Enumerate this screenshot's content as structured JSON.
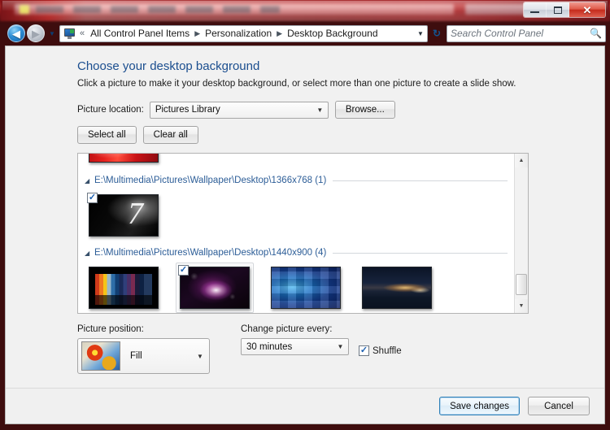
{
  "window": {
    "controls": {
      "minimize": "Minimize",
      "maximize": "Maximize",
      "close": "✕"
    }
  },
  "navbar": {
    "back_glyph": "◀",
    "forward_glyph": "▶",
    "history_glyph": "▼",
    "control_panel_icon": "control-panel-icon",
    "double_chevron": "«",
    "breadcrumbs": [
      "All Control Panel Items",
      "Personalization",
      "Desktop Background"
    ],
    "crumb_arrow": "▶",
    "dropdown_glyph": "▼",
    "refresh_glyph": "↻",
    "search": {
      "placeholder": "Search Control Panel",
      "icon": "🔍"
    }
  },
  "page": {
    "title": "Choose your desktop background",
    "subtitle": "Click a picture to make it your desktop background, or select more than one picture to create a slide show."
  },
  "location": {
    "label": "Picture location:",
    "value": "Pictures Library",
    "arrow": "▼",
    "browse_label": "Browse..."
  },
  "selection": {
    "select_all_label": "Select all",
    "clear_all_label": "Clear all"
  },
  "picture_list": {
    "partial_group_thumb": {
      "name": "red-abstract-wallpaper",
      "art": "wp-red",
      "checked": false
    },
    "groups": [
      {
        "arrow": "◢",
        "title": "E:\\Multimedia\\Pictures\\Wallpaper\\Desktop\\1366x768 (1)",
        "thumbs": [
          {
            "name": "windows-7-logo-wallpaper",
            "art": "wp-win7",
            "checked": true,
            "check_glyph": "✓"
          }
        ]
      },
      {
        "arrow": "◢",
        "title": "E:\\Multimedia\\Pictures\\Wallpaper\\Desktop\\1440x900 (4)",
        "thumbs": [
          {
            "name": "color-panels-wallpaper",
            "art": "wp-panels",
            "checked": false
          },
          {
            "name": "purple-nebula-wallpaper",
            "art": "wp-nebula",
            "checked": true,
            "check_glyph": "✓"
          },
          {
            "name": "blue-mosaic-wallpaper",
            "art": "wp-mosaic",
            "checked": false
          },
          {
            "name": "night-coast-wallpaper",
            "art": "wp-coast",
            "checked": false
          }
        ]
      }
    ],
    "scrollbar": {
      "up_glyph": "▲",
      "down_glyph": "▼"
    }
  },
  "picture_position": {
    "label": "Picture position:",
    "value": "Fill",
    "arrow": "▼",
    "preview": "flower-preview"
  },
  "interval": {
    "label": "Change picture every:",
    "value": "30 minutes",
    "arrow": "▼"
  },
  "shuffle": {
    "label": "Shuffle",
    "checked": true,
    "check_glyph": "✓"
  },
  "command_bar": {
    "save_label": "Save changes",
    "cancel_label": "Cancel"
  },
  "colors": {
    "frame": "#b41a1d",
    "title_link": "#1b4e8f",
    "group_title": "#2c5d97",
    "default_button_border": "#2c7fb8"
  }
}
